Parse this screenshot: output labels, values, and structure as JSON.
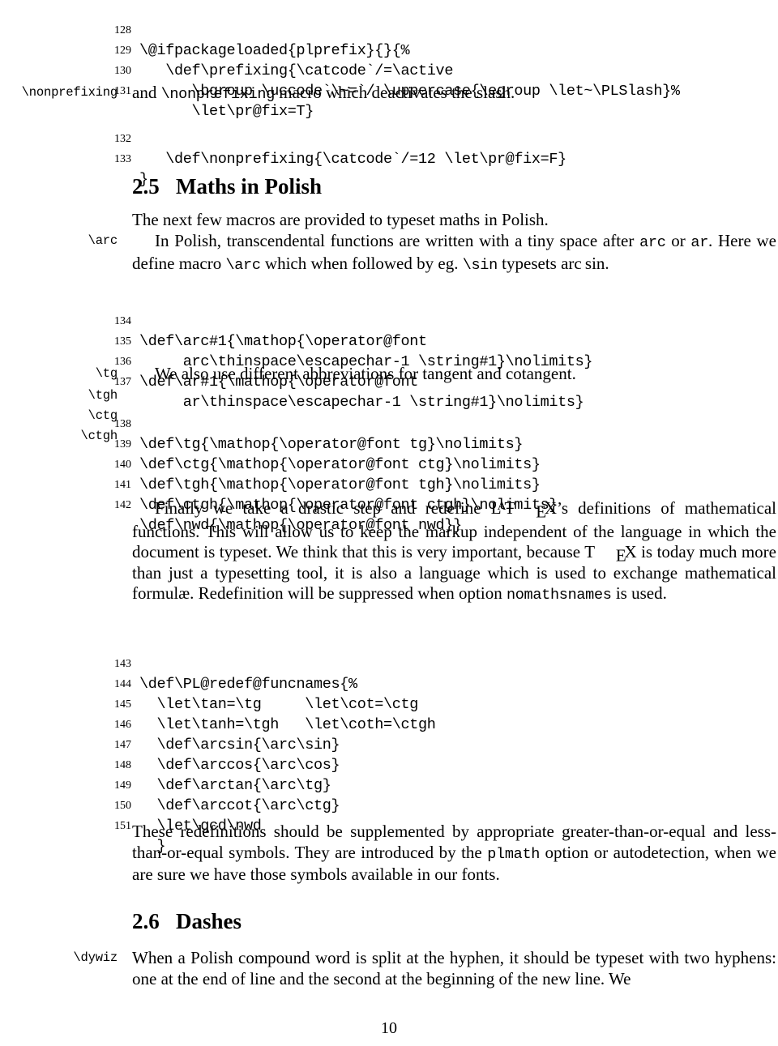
{
  "document": {
    "page_number": "10",
    "top_code_block": [
      {
        "number": "128",
        "source": "\\@ifpackageloaded{plprefix}{}{%"
      },
      {
        "number": "129",
        "source": "   \\def\\prefixing{\\catcode`/=\\active"
      },
      {
        "number": "130",
        "source": "      \\bgroup \\uccode`\\~=`/ \\uppercase{\\egroup \\let~\\PLSlash}%"
      },
      {
        "number": "131",
        "source": "      \\let\\pr@fix=T}"
      }
    ],
    "nonprefixing_note": {
      "margin_label": "\\nonprefixing",
      "text_before": "and ",
      "macro": "\\nonprefixing",
      "text_after": " macro which deactivates the slash."
    },
    "nonprefixing_code_block": [
      {
        "number": "132",
        "source": "   \\def\\nonprefixing{\\catcode`/=12 \\let\\pr@fix=F}"
      },
      {
        "number": "133",
        "source": "}"
      }
    ],
    "section_maths": {
      "number": "2.5",
      "title": "Maths in Polish"
    },
    "maths_intro": "The next few macros are provided to typeset maths in Polish.",
    "arc_margin_label": "\\arc",
    "arc_paragraph": {
      "p1": "In Polish, transcendental functions are written with a tiny space after ",
      "c1": "arc",
      "p2": " or ",
      "c2": "ar",
      "p3": ". Here we define macro ",
      "c3": "\\arc",
      "p4": " which when followed by eg. ",
      "c4": "\\sin",
      "p5": " typesets arc sin."
    },
    "arc_code_block": [
      {
        "number": "134",
        "source": "\\def\\arc#1{\\mathop{\\operator@font"
      },
      {
        "number": "135",
        "source": "     arc\\thinspace\\escapechar-1 \\string#1}\\nolimits}"
      },
      {
        "number": "136",
        "source": "\\def\\ar#1{\\mathop{\\operator@font"
      },
      {
        "number": "137",
        "source": "     ar\\thinspace\\escapechar-1 \\string#1}\\nolimits}"
      }
    ],
    "tg_margin_labels": [
      "\\tg",
      "\\tgh",
      "\\ctg",
      "\\ctgh"
    ],
    "tg_paragraph": "We also use different abbreviations for tangent and cotangent.",
    "tg_code_block": [
      {
        "number": "138",
        "source": "\\def\\tg{\\mathop{\\operator@font tg}\\nolimits}"
      },
      {
        "number": "139",
        "source": "\\def\\ctg{\\mathop{\\operator@font ctg}\\nolimits}"
      },
      {
        "number": "140",
        "source": "\\def\\tgh{\\mathop{\\operator@font tgh}\\nolimits}"
      },
      {
        "number": "141",
        "source": "\\def\\ctgh{\\mathop{\\operator@font ctgh}\\nolimits}"
      },
      {
        "number": "142",
        "source": "\\def\\nwd{\\mathop{\\operator@font nwd}}"
      }
    ],
    "finally_paragraph": {
      "p1": "Finally we take a drastic step and redefine ",
      "logo1": "LaTeX",
      "p2": "’s definitions of mathematical functions. This will allow us to keep the markup independent of the language in which the document is typeset. We think that this is very important, because ",
      "logo2": "TeX",
      "p3": " is today much more than just a typesetting tool, it is also a language which is used to exchange mathematical formulæ. Redefinition will be suppressed when option ",
      "c1": "nomathsnames",
      "p4": " is used."
    },
    "redef_code_block": [
      {
        "number": "143",
        "source": "\\def\\PL@redef@funcnames{%"
      },
      {
        "number": "144",
        "source": "  \\let\\tan=\\tg     \\let\\cot=\\ctg"
      },
      {
        "number": "145",
        "source": "  \\let\\tanh=\\tgh   \\let\\coth=\\ctgh"
      },
      {
        "number": "146",
        "source": "  \\def\\arcsin{\\arc\\sin}"
      },
      {
        "number": "147",
        "source": "  \\def\\arccos{\\arc\\cos}"
      },
      {
        "number": "148",
        "source": "  \\def\\arctan{\\arc\\tg}"
      },
      {
        "number": "149",
        "source": "  \\def\\arccot{\\arc\\ctg}"
      },
      {
        "number": "150",
        "source": "  \\let\\gcd\\nwd"
      },
      {
        "number": "151",
        "source": "  }"
      }
    ],
    "redefinitions_paragraph": {
      "p1": "These redefinitions should be supplemented by appropriate greater-than-or-equal and less-than-or-equal symbols. They are introduced by the ",
      "c1": "plmath",
      "p2": " option or autodetection, when we are sure we have those symbols available in our fonts."
    },
    "section_dashes": {
      "number": "2.6",
      "title": "Dashes"
    },
    "dywiz_margin_label": "\\dywiz",
    "dywiz_paragraph": "When a Polish compound word is split at the hyphen, it should be typeset with two hyphens: one at the end of line and the second at the beginning of the new line. We"
  }
}
